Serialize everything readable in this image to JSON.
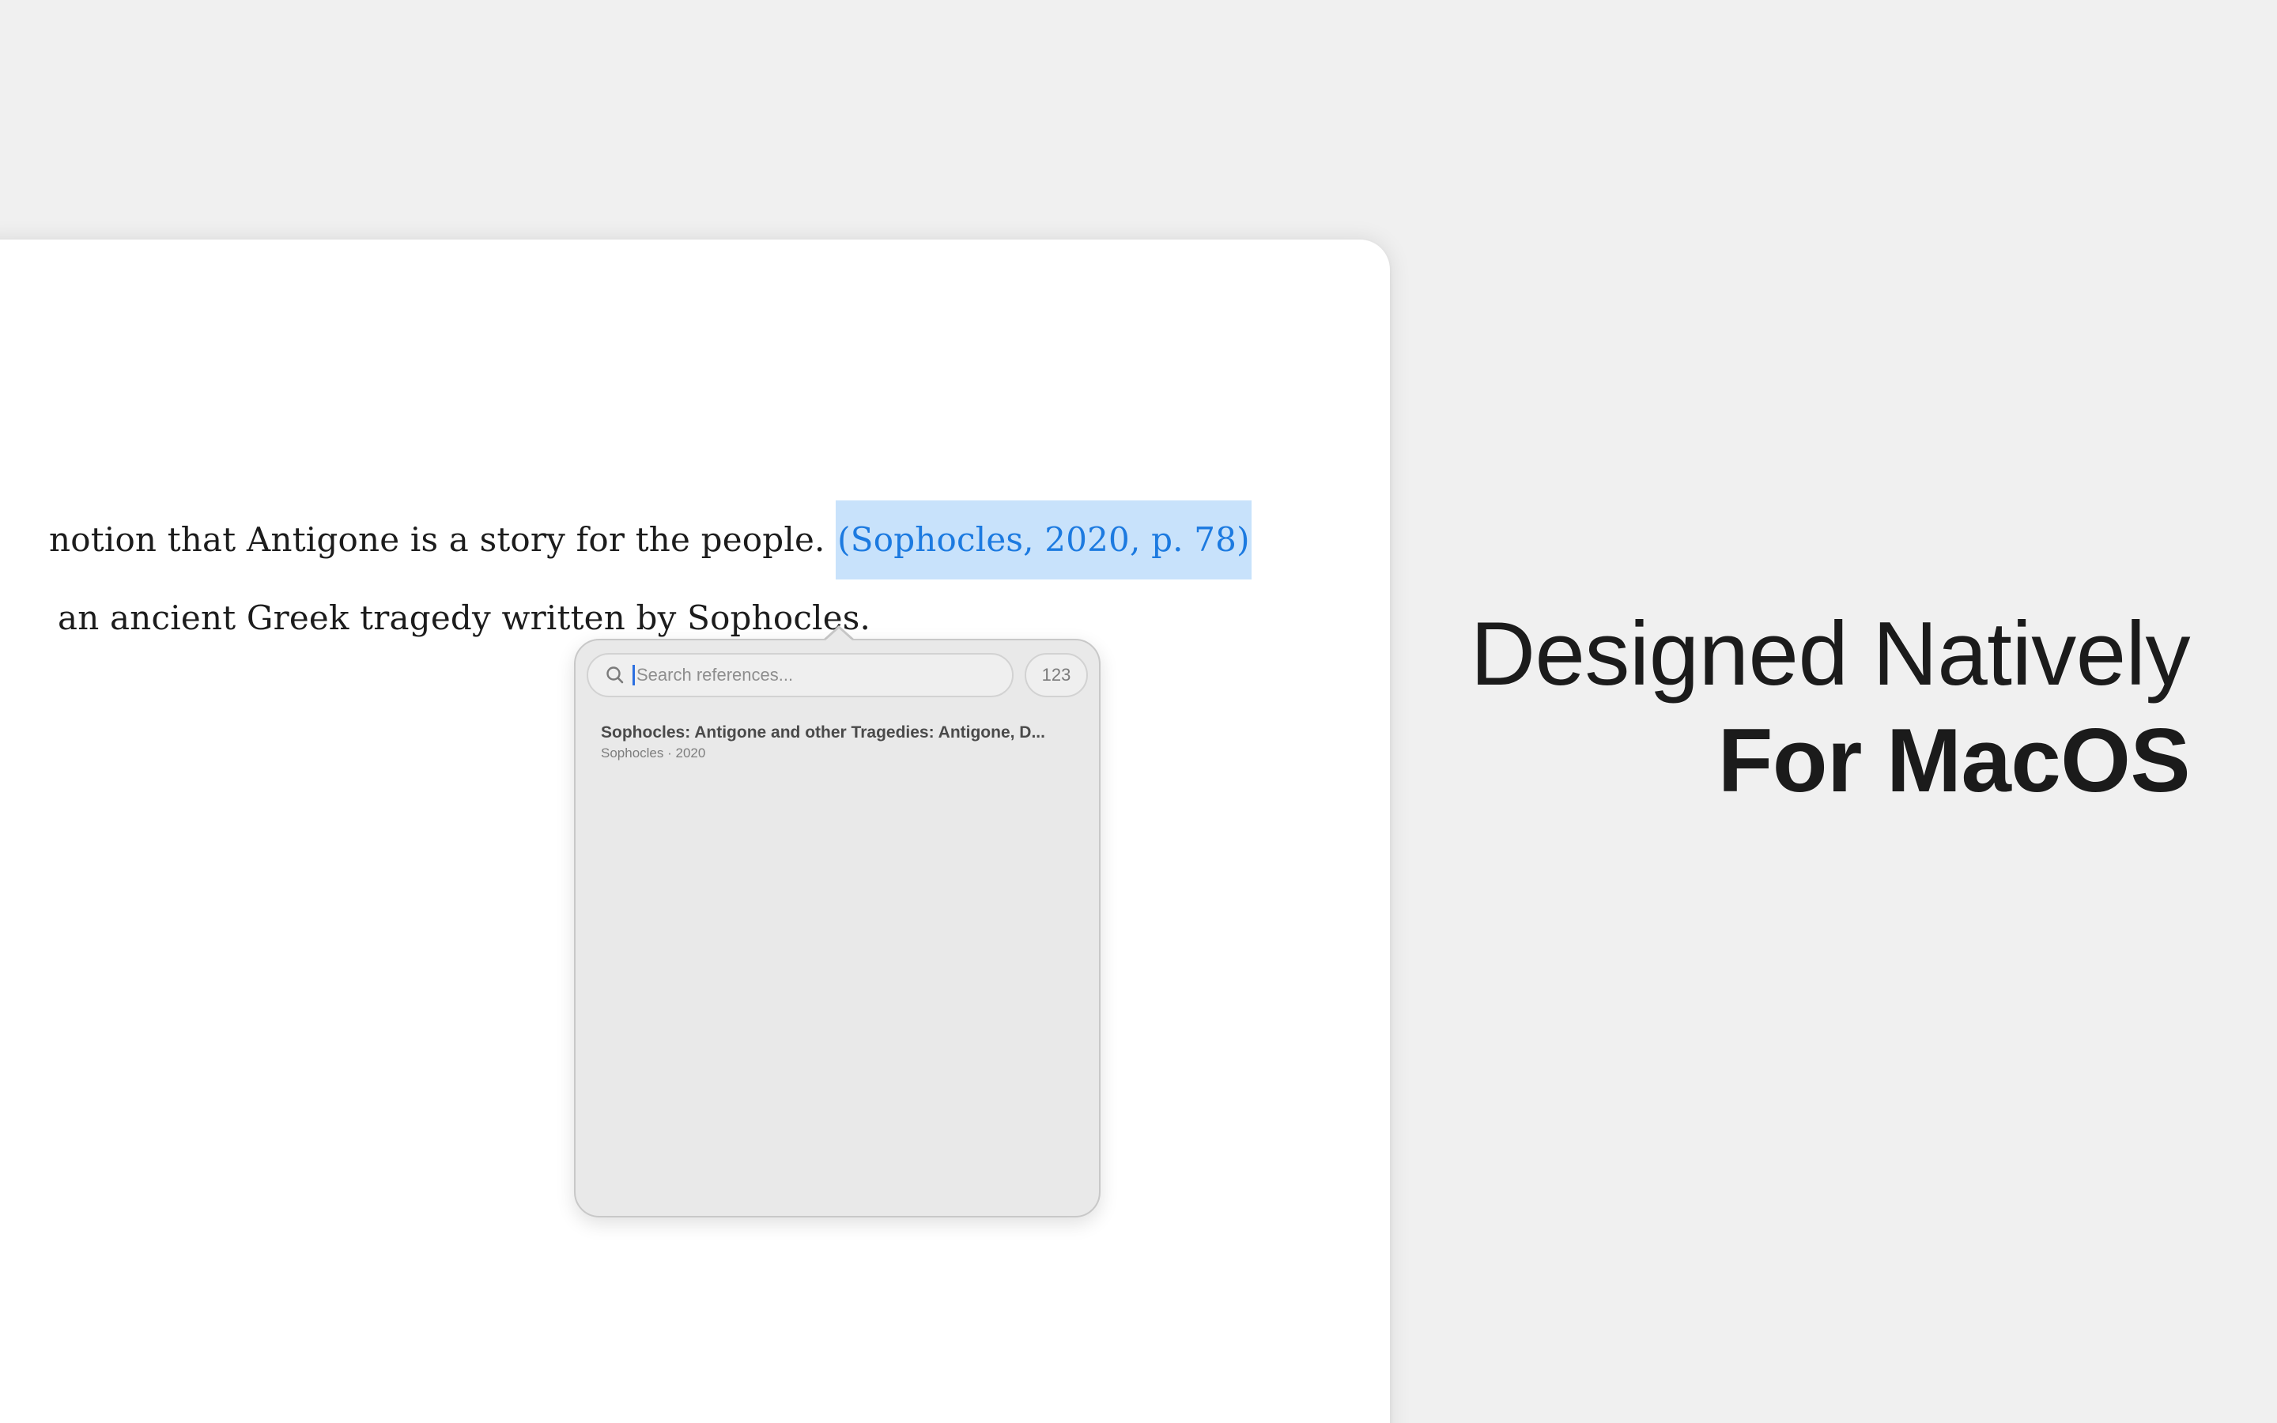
{
  "document": {
    "line1_text": "notion that Antigone is a story for the people. ",
    "citation": "(Sophocles, 2020, p. 78)",
    "line2_text": "an ancient Greek tragedy written by Sophocles."
  },
  "popover": {
    "search_placeholder": "Search references...",
    "search_value": "",
    "count_label": "123",
    "results": [
      {
        "title": "Sophocles: Antigone and other Tragedies: Antigone, D...",
        "meta": "Sophocles · 2020"
      }
    ]
  },
  "tagline": {
    "line1": "Designed Natively",
    "line2": "For MacOS"
  },
  "colors": {
    "background": "#f0f0f0",
    "citation_highlight": "#c8e2fb",
    "citation_text": "#1c7ae0",
    "caret": "#2b6fe0"
  },
  "icons": [
    "search-icon"
  ]
}
